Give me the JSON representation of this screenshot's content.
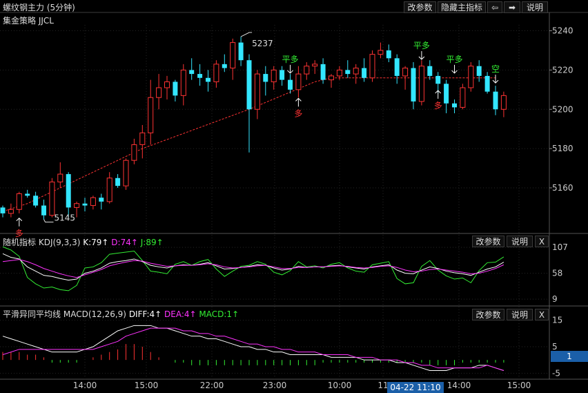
{
  "header": {
    "title": "螺纹钢主力 (5分钟)",
    "strategy": "集金策略 JJCL",
    "buttons": [
      "改参数",
      "隐藏主指标",
      "⇦",
      "➡",
      "说明"
    ]
  },
  "kdj_panel": {
    "name": "随机指标",
    "params": "KDJ(9,3,3)",
    "k_label": "K:79↑",
    "d_label": "D:74↑",
    "j_label": "J:89↑",
    "buttons": [
      "改参数",
      "说明",
      "X"
    ],
    "colors": {
      "k": "#ffffff",
      "d": "#ff33ff",
      "j": "#33ee33"
    }
  },
  "macd_panel": {
    "name": "平滑异同平均线",
    "params": "MACD(12,26,9)",
    "diff_label": "DIFF:4↑",
    "dea_label": "DEA:4↑",
    "macd_label": "MACD:1↑",
    "buttons": [
      "改参数",
      "说明",
      "X"
    ],
    "value_tag": "1",
    "colors": {
      "diff": "#ffffff",
      "dea": "#ff33ff",
      "macd_pos": "#ff3333",
      "macd_neg": "#33ee33"
    }
  },
  "time_axis": {
    "labels": [
      "14:00",
      "15:00",
      "22:00",
      "23:00",
      "10:00",
      "11",
      "14:00",
      "15:00"
    ],
    "cursor_label": "04-22 11:10"
  },
  "chart_data": {
    "type": "candlestick",
    "main_axis": {
      "ticks": [
        5240,
        5220,
        5200,
        5180,
        5160
      ],
      "range": [
        5141,
        5243
      ]
    },
    "kdj_axis": {
      "ticks": [
        107,
        58,
        9
      ],
      "range": [
        0,
        115
      ]
    },
    "macd_axis": {
      "ticks": [
        15,
        5,
        -5
      ],
      "range": [
        -7,
        17
      ]
    },
    "annotations": {
      "high": "5237",
      "low": "5145"
    },
    "signals": [
      {
        "text": "多",
        "dir": "up",
        "bar": 2,
        "price": 5146,
        "color": "#ff3333"
      },
      {
        "text": "平多",
        "dir": "down",
        "bar": 35,
        "price": 5217,
        "color": "#33ee33"
      },
      {
        "text": "多",
        "dir": "up",
        "bar": 36,
        "price": 5207,
        "color": "#ff3333"
      },
      {
        "text": "平多",
        "dir": "down",
        "bar": 51,
        "price": 5224,
        "color": "#33ee33"
      },
      {
        "text": "多",
        "dir": "up",
        "bar": 53,
        "price": 5211,
        "color": "#ff3333"
      },
      {
        "text": "平多",
        "dir": "down",
        "bar": 55,
        "price": 5217,
        "color": "#33ee33"
      },
      {
        "text": "空",
        "dir": "down",
        "bar": 60,
        "price": 5212,
        "color": "#33ee33"
      }
    ],
    "trend_line": [
      [
        0,
        5148
      ],
      [
        3,
        5152
      ],
      [
        17,
        5180
      ],
      [
        30,
        5200
      ],
      [
        38,
        5214
      ],
      [
        40,
        5216
      ],
      [
        60,
        5216
      ]
    ],
    "candles": [
      [
        5150,
        5151,
        5145,
        5147
      ],
      [
        5147,
        5152,
        5145,
        5149
      ],
      [
        5149,
        5158,
        5147,
        5157
      ],
      [
        5157,
        5159,
        5155,
        5156
      ],
      [
        5156,
        5158,
        5150,
        5151
      ],
      [
        5151,
        5154,
        5144,
        5146
      ],
      [
        5146,
        5165,
        5145,
        5163
      ],
      [
        5163,
        5173,
        5160,
        5167
      ],
      [
        5167,
        5168,
        5145,
        5150
      ],
      [
        5150,
        5153,
        5145,
        5152
      ],
      [
        5152,
        5155,
        5148,
        5151
      ],
      [
        5151,
        5156,
        5149,
        5155
      ],
      [
        5155,
        5157,
        5149,
        5153
      ],
      [
        5153,
        5168,
        5152,
        5165
      ],
      [
        5165,
        5167,
        5160,
        5161
      ],
      [
        5161,
        5175,
        5159,
        5174
      ],
      [
        5174,
        5185,
        5172,
        5182
      ],
      [
        5182,
        5192,
        5175,
        5188
      ],
      [
        5188,
        5215,
        5182,
        5206
      ],
      [
        5206,
        5218,
        5200,
        5211
      ],
      [
        5211,
        5217,
        5205,
        5214
      ],
      [
        5214,
        5215,
        5204,
        5207
      ],
      [
        5207,
        5223,
        5202,
        5220
      ],
      [
        5220,
        5226,
        5215,
        5218
      ],
      [
        5218,
        5223,
        5212,
        5216
      ],
      [
        5216,
        5220,
        5209,
        5214
      ],
      [
        5214,
        5225,
        5211,
        5223
      ],
      [
        5223,
        5228,
        5219,
        5221
      ],
      [
        5221,
        5236,
        5215,
        5234
      ],
      [
        5234,
        5237,
        5222,
        5225
      ],
      [
        5225,
        5228,
        5178,
        5200
      ],
      [
        5200,
        5220,
        5195,
        5218
      ],
      [
        5218,
        5222,
        5207,
        5214
      ],
      [
        5214,
        5222,
        5210,
        5220
      ],
      [
        5220,
        5222,
        5212,
        5215
      ],
      [
        5215,
        5218,
        5208,
        5210
      ],
      [
        5210,
        5222,
        5206,
        5218
      ],
      [
        5218,
        5224,
        5215,
        5222
      ],
      [
        5222,
        5225,
        5218,
        5223
      ],
      [
        5223,
        5226,
        5213,
        5215
      ],
      [
        5215,
        5218,
        5211,
        5217
      ],
      [
        5217,
        5222,
        5215,
        5220
      ],
      [
        5220,
        5225,
        5216,
        5218
      ],
      [
        5218,
        5223,
        5213,
        5221
      ],
      [
        5221,
        5226,
        5214,
        5216
      ],
      [
        5216,
        5230,
        5214,
        5228
      ],
      [
        5228,
        5234,
        5226,
        5230
      ],
      [
        5230,
        5233,
        5224,
        5226
      ],
      [
        5226,
        5228,
        5213,
        5217
      ],
      [
        5217,
        5222,
        5210,
        5221
      ],
      [
        5221,
        5224,
        5200,
        5204
      ],
      [
        5204,
        5225,
        5202,
        5222
      ],
      [
        5222,
        5225,
        5215,
        5217
      ],
      [
        5217,
        5219,
        5208,
        5213
      ],
      [
        5213,
        5215,
        5198,
        5203
      ],
      [
        5203,
        5205,
        5198,
        5201
      ],
      [
        5201,
        5213,
        5200,
        5211
      ],
      [
        5211,
        5224,
        5209,
        5222
      ],
      [
        5222,
        5225,
        5214,
        5217
      ],
      [
        5217,
        5219,
        5208,
        5209
      ],
      [
        5209,
        5212,
        5197,
        5200
      ],
      [
        5200,
        5209,
        5196,
        5207
      ]
    ],
    "kdj": {
      "k": [
        95,
        88,
        85,
        70,
        62,
        54,
        52,
        48,
        45,
        47,
        58,
        62,
        68,
        77,
        80,
        82,
        85,
        80,
        73,
        70,
        68,
        72,
        74,
        73,
        75,
        78,
        72,
        66,
        67,
        69,
        71,
        74,
        73,
        68,
        64,
        66,
        71,
        69,
        70,
        70,
        72,
        73,
        70,
        68,
        66,
        70,
        72,
        74,
        64,
        58,
        57,
        64,
        70,
        67,
        62,
        59,
        57,
        54,
        60,
        66,
        70,
        79
      ],
      "d": [
        80,
        82,
        84,
        80,
        74,
        67,
        62,
        57,
        53,
        50,
        55,
        60,
        65,
        72,
        76,
        79,
        82,
        81,
        77,
        74,
        71,
        72,
        73,
        73,
        74,
        76,
        74,
        70,
        68,
        69,
        70,
        72,
        73,
        70,
        67,
        67,
        69,
        69,
        70,
        70,
        71,
        72,
        71,
        69,
        68,
        69,
        71,
        72,
        69,
        64,
        61,
        62,
        65,
        66,
        64,
        62,
        60,
        57,
        58,
        62,
        67,
        74
      ],
      "j": [
        108,
        102,
        90,
        50,
        38,
        30,
        32,
        27,
        25,
        35,
        68,
        70,
        78,
        94,
        96,
        98,
        100,
        82,
        62,
        60,
        57,
        75,
        80,
        73,
        80,
        84,
        66,
        52,
        62,
        71,
        73,
        80,
        75,
        60,
        55,
        63,
        80,
        70,
        72,
        68,
        75,
        78,
        68,
        62,
        60,
        74,
        77,
        80,
        48,
        38,
        40,
        71,
        82,
        64,
        53,
        47,
        49,
        40,
        63,
        78,
        79,
        89
      ]
    },
    "macd": {
      "diff": [
        9,
        8,
        7,
        6,
        5,
        4,
        3,
        3,
        3,
        3,
        4,
        5,
        7,
        9,
        11,
        12,
        13,
        13,
        13,
        12,
        12,
        11,
        10,
        9,
        9,
        8,
        8,
        7,
        6,
        5,
        5,
        4,
        4,
        3,
        3,
        2,
        2,
        2,
        2,
        2,
        1,
        1,
        1,
        1,
        0,
        0,
        0,
        0,
        -1,
        -1,
        -2,
        -3,
        -4,
        -4,
        -4,
        -3,
        -3,
        -3,
        -2,
        -2,
        -3,
        -4
      ],
      "dea": [
        2,
        3,
        4,
        4,
        4,
        4,
        4,
        4,
        4,
        4,
        4,
        4,
        5,
        6,
        7,
        9,
        10,
        11,
        12,
        12,
        12,
        12,
        11,
        11,
        10,
        10,
        9,
        9,
        8,
        7,
        6,
        6,
        5,
        5,
        4,
        4,
        3,
        3,
        3,
        2,
        2,
        2,
        2,
        1,
        1,
        1,
        0,
        0,
        0,
        -1,
        -1,
        -2,
        -2,
        -3,
        -3,
        -3,
        -3,
        -3,
        -3,
        -2,
        -3,
        -4
      ],
      "bar": [
        3,
        3,
        3,
        2,
        2,
        1,
        -1,
        -1,
        -1,
        -1,
        0,
        1,
        2,
        3,
        4,
        6,
        6,
        5,
        3,
        1,
        0,
        -1,
        -1,
        -2,
        -2,
        -2,
        -2,
        -2,
        -2,
        -2,
        -2,
        -2,
        -2,
        -2,
        -2,
        -2,
        -2,
        -2,
        -2,
        -1,
        -1,
        -1,
        -1,
        -1,
        -1,
        -1,
        -1,
        -1,
        -1,
        -1,
        -1,
        -1,
        -2,
        -2,
        -2,
        -2,
        -1,
        -1,
        -1,
        -1,
        -1,
        -1
      ]
    }
  }
}
